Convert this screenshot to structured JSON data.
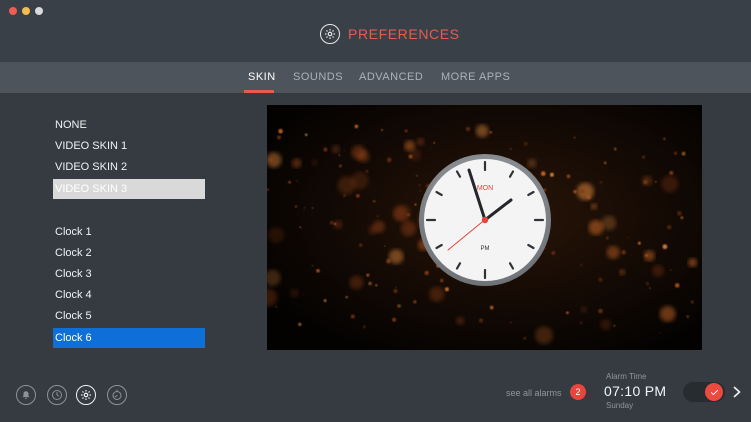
{
  "window": {
    "title": "PREFERENCES",
    "title_icon": "gear-icon"
  },
  "tabs": [
    {
      "label": "SKIN",
      "active": true
    },
    {
      "label": "SOUNDS",
      "active": false
    },
    {
      "label": "ADVANCED",
      "active": false
    },
    {
      "label": "MORE APPS",
      "active": false
    }
  ],
  "skins": {
    "items": [
      "NONE",
      "VIDEO SKIN 1",
      "VIDEO SKIN 2",
      "VIDEO SKIN 3"
    ],
    "selected": "VIDEO SKIN 3"
  },
  "clocks": {
    "items": [
      "Clock 1",
      "Clock 2",
      "Clock 3",
      "Clock 4",
      "Clock 5",
      "Clock 6"
    ],
    "selected": "Clock 6"
  },
  "preview": {
    "clock_day": "MON",
    "clock_ampm": "PM"
  },
  "bottom": {
    "icons": [
      "bell-icon",
      "clock-icon",
      "gear-icon",
      "stopwatch-icon"
    ],
    "active_icon": "gear-icon",
    "see_all_label": "see all alarms",
    "alarm_count": "2",
    "alarm_label": "Alarm Time",
    "alarm_time": "07:10 PM",
    "alarm_day": "Sunday",
    "toggle_on": true
  },
  "colors": {
    "accent": "#e85b4f",
    "selection_blue": "#0e6fd8",
    "badge": "#e8453c"
  }
}
